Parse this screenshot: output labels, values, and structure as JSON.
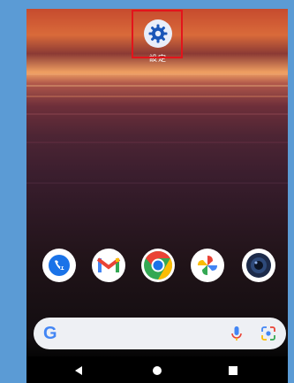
{
  "home": {
    "settings_label": "設定"
  },
  "dock": {
    "apps": [
      "phone-app",
      "gmail-app",
      "chrome-app",
      "photos-app",
      "camera-app"
    ]
  },
  "search": {
    "placeholder": ""
  },
  "nav": {
    "back": "back-button",
    "home": "home-button",
    "recents": "recents-button"
  },
  "colors": {
    "highlight": "#e3141b",
    "background": "#5b9bd5"
  }
}
